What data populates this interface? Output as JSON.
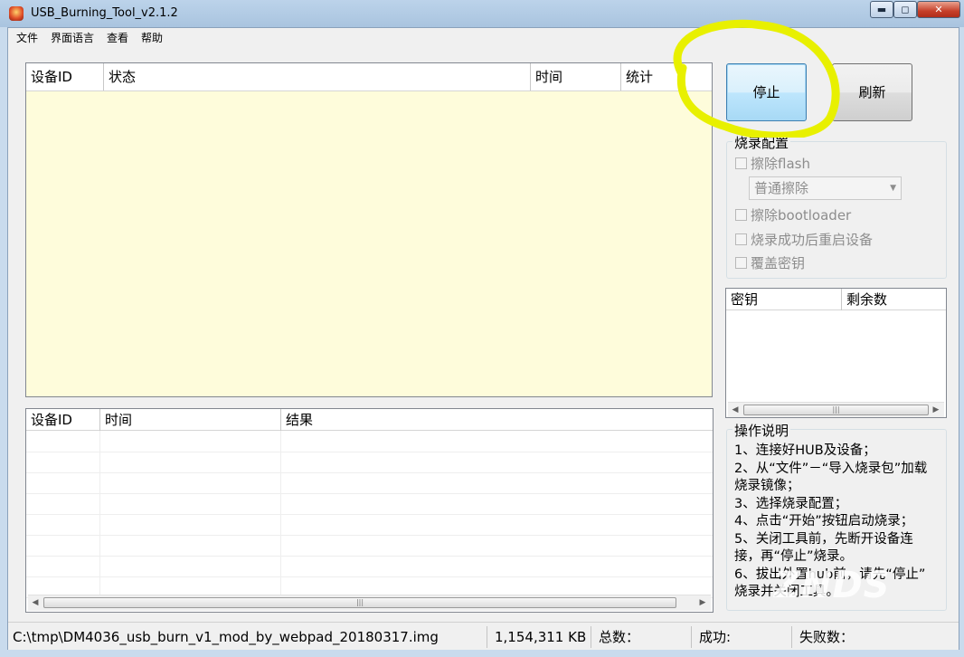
{
  "window": {
    "title": "USB_Burning_Tool_v2.1.2",
    "controls": {
      "minimize": "▬",
      "maximize": "◻",
      "close": "✕"
    }
  },
  "menu": [
    "文件",
    "界面语言",
    "查看",
    "帮助"
  ],
  "device_table": {
    "columns": [
      "设备ID",
      "状态",
      "时间",
      "统计"
    ],
    "background": "#fefcdb"
  },
  "result_table": {
    "columns": [
      "设备ID",
      "时间",
      "结果"
    ],
    "rows": 8
  },
  "buttons": {
    "stop": "停止",
    "refresh": "刷新"
  },
  "burn_config": {
    "title": "烧录配置",
    "erase_flash": "擦除flash",
    "erase_mode": "普通擦除",
    "erase_bootloader": "擦除bootloader",
    "reboot_after": "烧录成功后重启设备",
    "overwrite_key": "覆盖密钥"
  },
  "key_table": {
    "columns": [
      "密钥",
      "剩余数"
    ]
  },
  "instructions": {
    "title": "操作说明",
    "lines": [
      "1、连接好HUB及设备；",
      "2、从“文件”－“导入烧录包”加载",
      "烧录镜像；",
      "3、选择烧录配置；",
      "4、点击“开始”按钮启动烧录；",
      "5、关闭工具前，先断开设备连",
      "接，再“停止”烧录。",
      "6、拔出外置hub前，请先“停止”",
      "烧录并关闭工具。"
    ]
  },
  "statusbar": {
    "path": "C:\\tmp\\DM4036_usb_burn_v1_mod_by_webpad_20180317.img",
    "size": "1,154,311 KB",
    "total_label": "总数：",
    "success_label": "成功:",
    "fail_label": "失败数："
  },
  "watermark": "ZNDS",
  "colors": {
    "annotation": "#e8f000"
  }
}
